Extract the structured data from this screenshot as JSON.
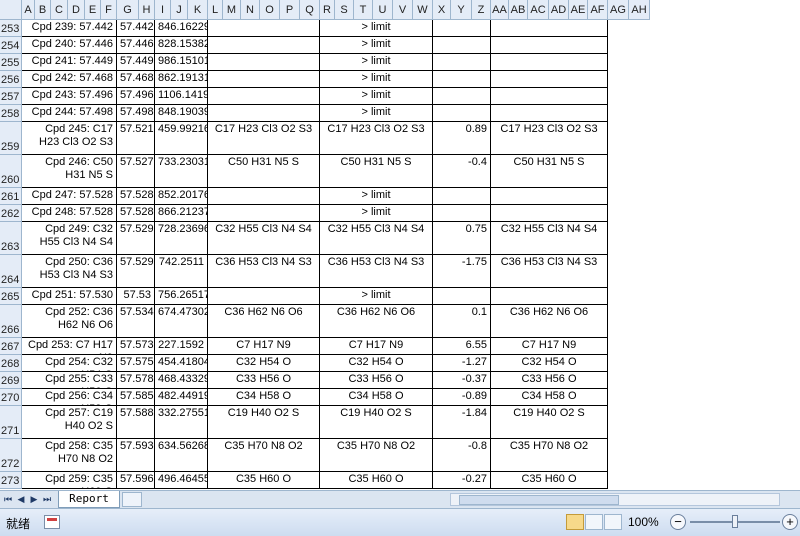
{
  "columns": [
    "A",
    "B",
    "C",
    "D",
    "E",
    "F",
    "G",
    "H",
    "I",
    "J",
    "K",
    "L",
    "M",
    "N",
    "O",
    "P",
    "Q",
    "R",
    "S",
    "T",
    "U",
    "V",
    "W",
    "X",
    "Y",
    "Z",
    "AA",
    "AB",
    "AC",
    "AD",
    "AE",
    "AF",
    "AG",
    "AH"
  ],
  "rows": [
    {
      "num": "253",
      "a": "Cpd 239: 57.442",
      "g": "57.442",
      "i": "846.16229",
      "l": "",
      "r": "> limit",
      "x": "",
      "aa": ""
    },
    {
      "num": "254",
      "a": "Cpd 240: 57.446",
      "g": "57.446",
      "i": "828.15382",
      "l": "",
      "r": "> limit",
      "x": "",
      "aa": ""
    },
    {
      "num": "255",
      "a": "Cpd 241: 57.449",
      "g": "57.449",
      "i": "986.15101",
      "l": "",
      "r": "> limit",
      "x": "",
      "aa": ""
    },
    {
      "num": "256",
      "a": "Cpd 242: 57.468",
      "g": "57.468",
      "i": "862.19131",
      "l": "",
      "r": "> limit",
      "x": "",
      "aa": ""
    },
    {
      "num": "257",
      "a": "Cpd 243: 57.496",
      "g": "57.496",
      "i": "1106.14192",
      "l": "",
      "r": "> limit",
      "x": "",
      "aa": ""
    },
    {
      "num": "258",
      "a": "Cpd 244: 57.498",
      "g": "57.498",
      "i": "848.19039",
      "l": "",
      "r": "> limit",
      "x": "",
      "aa": ""
    },
    {
      "num": "259",
      "a": "Cpd 245: C17 H23 Cl3 O2 S3",
      "g": "57.521",
      "i": "459.99216",
      "l": "C17 H23 Cl3 O2 S3",
      "r": "C17 H23 Cl3 O2 S3",
      "x": "0.89",
      "aa": "C17 H23 Cl3 O2 S3"
    },
    {
      "num": "260",
      "a": "Cpd 246: C50 H31 N5 S",
      "g": "57.527",
      "i": "733.23031",
      "l": "C50 H31 N5 S",
      "r": "C50 H31 N5 S",
      "x": "-0.4",
      "aa": "C50 H31 N5 S"
    },
    {
      "num": "261",
      "a": "Cpd 247: 57.528",
      "g": "57.528",
      "i": "852.20176",
      "l": "",
      "r": "> limit",
      "x": "",
      "aa": ""
    },
    {
      "num": "262",
      "a": "Cpd 248: 57.528",
      "g": "57.528",
      "i": "866.21237",
      "l": "",
      "r": "> limit",
      "x": "",
      "aa": ""
    },
    {
      "num": "263",
      "a": "Cpd 249: C32 H55 Cl3 N4 S4",
      "g": "57.529",
      "i": "728.23696",
      "l": "C32 H55 Cl3 N4 S4",
      "r": "C32 H55 Cl3 N4 S4",
      "x": "0.75",
      "aa": "C32 H55 Cl3 N4 S4"
    },
    {
      "num": "264",
      "a": "Cpd 250: C36 H53 Cl3 N4 S3",
      "g": "57.529",
      "i": "742.2511",
      "l": "C36 H53 Cl3 N4 S3",
      "r": "C36 H53 Cl3 N4 S3",
      "x": "-1.75",
      "aa": "C36 H53 Cl3 N4 S3"
    },
    {
      "num": "265",
      "a": "Cpd 251: 57.530",
      "g": "57.53",
      "i": "756.26517",
      "l": "",
      "r": "> limit",
      "x": "",
      "aa": ""
    },
    {
      "num": "266",
      "a": "Cpd 252: C36 H62 N6 O6",
      "g": "57.534",
      "i": "674.47302",
      "l": "C36 H62 N6 O6",
      "r": "C36 H62 N6 O6",
      "x": "0.1",
      "aa": "C36 H62 N6 O6"
    },
    {
      "num": "267",
      "a": "Cpd 253: C7 H17 N9",
      "g": "57.573",
      "i": "227.1592",
      "l": "C7 H17 N9",
      "r": "C7 H17 N9",
      "x": "6.55",
      "aa": "C7 H17 N9"
    },
    {
      "num": "268",
      "a": "Cpd 254: C32 H54 O",
      "g": "57.575",
      "i": "454.41804",
      "l": "C32 H54 O",
      "r": "C32 H54 O",
      "x": "-1.27",
      "aa": "C32 H54 O"
    },
    {
      "num": "269",
      "a": "Cpd 255: C33 H56 O",
      "g": "57.578",
      "i": "468.43329",
      "l": "C33 H56 O",
      "r": "C33 H56 O",
      "x": "-0.37",
      "aa": "C33 H56 O"
    },
    {
      "num": "270",
      "a": "Cpd 256: C34 H58 O",
      "g": "57.585",
      "i": "482.44919",
      "l": "C34 H58 O",
      "r": "C34 H58 O",
      "x": "-0.89",
      "aa": "C34 H58 O"
    },
    {
      "num": "271",
      "a": "Cpd 257: C19 H40 O2 S",
      "g": "57.588",
      "i": "332.27551",
      "l": "C19 H40 O2 S",
      "r": "C19 H40 O2 S",
      "x": "-1.84",
      "aa": "C19 H40 O2 S"
    },
    {
      "num": "272",
      "a": "Cpd 258: C35 H70 N8 O2",
      "g": "57.593",
      "i": "634.56268",
      "l": "C35 H70 N8 O2",
      "r": "C35 H70 N8 O2",
      "x": "-0.8",
      "aa": "C35 H70 N8 O2"
    },
    {
      "num": "273",
      "a": "Cpd 259: C35 H60 O",
      "g": "57.596",
      "i": "496.46455",
      "l": "C35 H60 O",
      "r": "C35 H60 O",
      "x": "-0.27",
      "aa": "C35 H60 O"
    }
  ],
  "sheet_tab": "Report",
  "status": "就绪",
  "zoom": "100%",
  "nav": {
    "first": "⏮",
    "prev": "◀",
    "next": "▶",
    "last": "⏭"
  }
}
